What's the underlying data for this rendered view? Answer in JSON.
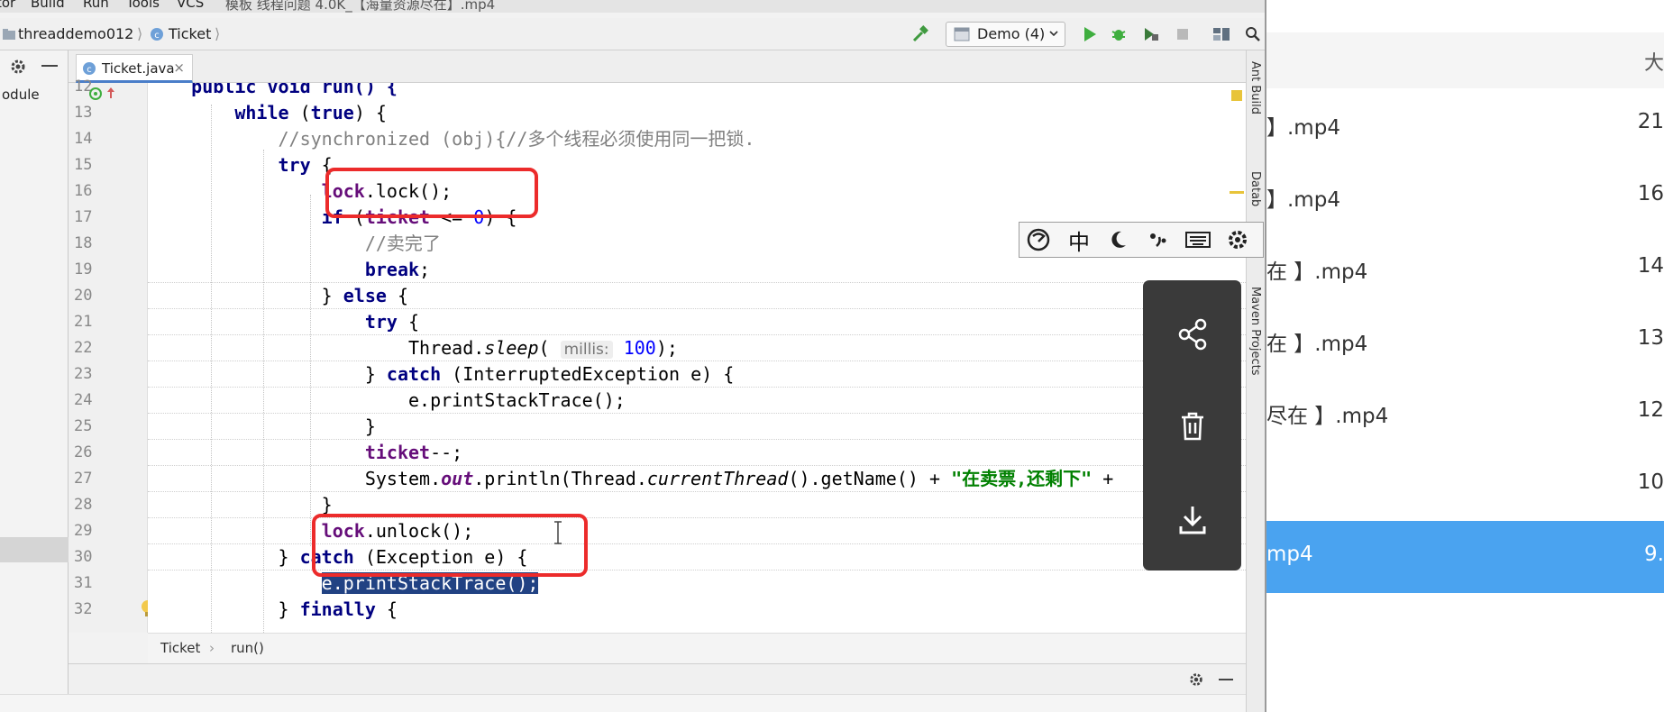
{
  "menu": {
    "items": [
      "tor",
      "Build",
      "Run",
      "Tools",
      "VCS"
    ],
    "title_fragment": "模板 线程问题 4.0K_【海量资源尽在】.mp4"
  },
  "breadcrumb": {
    "project": "threaddemo012",
    "class": "Ticket"
  },
  "run_config": {
    "label": "Demo (4)"
  },
  "project_panel": {
    "label": "odule"
  },
  "editor_tab": {
    "label": "Ticket.java",
    "close": "×"
  },
  "code": {
    "line_numbers": [
      "12",
      "13",
      "14",
      "15",
      "16",
      "17",
      "18",
      "19",
      "20",
      "21",
      "22",
      "23",
      "24",
      "25",
      "26",
      "27",
      "28",
      "29",
      "30",
      "31",
      "32"
    ],
    "lines": [
      {
        "ln": "12",
        "parts": [
          {
            "t": "    public void run() {",
            "c": "kw"
          }
        ]
      },
      {
        "ln": "13",
        "parts": [
          {
            "t": "        while",
            "c": "kw"
          },
          {
            "t": " (",
            "c": ""
          },
          {
            "t": "true",
            "c": "kw"
          },
          {
            "t": ") {",
            "c": ""
          }
        ]
      },
      {
        "ln": "14",
        "parts": [
          {
            "t": "            //synchronized (obj){//多个线程必须使用同一把锁.",
            "c": "cm"
          }
        ]
      },
      {
        "ln": "15",
        "parts": [
          {
            "t": "            try",
            "c": "kw"
          },
          {
            "t": " {",
            "c": ""
          }
        ]
      },
      {
        "ln": "16",
        "parts": [
          {
            "t": "                ",
            "c": ""
          },
          {
            "t": "lock",
            "c": "fd2"
          },
          {
            "t": ".lock();",
            "c": ""
          }
        ]
      },
      {
        "ln": "17",
        "parts": [
          {
            "t": "                if",
            "c": "kw"
          },
          {
            "t": " (",
            "c": ""
          },
          {
            "t": "ticket",
            "c": "fd2"
          },
          {
            "t": " <= ",
            "c": ""
          },
          {
            "t": "0",
            "c": "nm"
          },
          {
            "t": ") {",
            "c": ""
          }
        ]
      },
      {
        "ln": "18",
        "parts": [
          {
            "t": "                    //卖完了",
            "c": "cm"
          }
        ]
      },
      {
        "ln": "19",
        "parts": [
          {
            "t": "                    break",
            "c": "kw"
          },
          {
            "t": ";",
            "c": ""
          }
        ]
      },
      {
        "ln": "20",
        "parts": [
          {
            "t": "                } ",
            "c": ""
          },
          {
            "t": "else",
            "c": "kw"
          },
          {
            "t": " {",
            "c": ""
          }
        ]
      },
      {
        "ln": "21",
        "parts": [
          {
            "t": "                    try",
            "c": "kw"
          },
          {
            "t": " {",
            "c": ""
          }
        ]
      },
      {
        "ln": "22",
        "parts": [
          {
            "t": "                        Thread.",
            "c": ""
          },
          {
            "t": "sleep",
            "c": "it"
          },
          {
            "t": "( ",
            "c": ""
          },
          {
            "t": "millis:",
            "c": "hint"
          },
          {
            "t": " ",
            "c": ""
          },
          {
            "t": "100",
            "c": "nm"
          },
          {
            "t": ");",
            "c": ""
          }
        ]
      },
      {
        "ln": "23",
        "parts": [
          {
            "t": "                    } ",
            "c": ""
          },
          {
            "t": "catch",
            "c": "kw"
          },
          {
            "t": " (InterruptedException e) {",
            "c": ""
          }
        ]
      },
      {
        "ln": "24",
        "parts": [
          {
            "t": "                        e.printStackTrace();",
            "c": ""
          }
        ]
      },
      {
        "ln": "25",
        "parts": [
          {
            "t": "                    }",
            "c": ""
          }
        ]
      },
      {
        "ln": "26",
        "parts": [
          {
            "t": "                    ",
            "c": ""
          },
          {
            "t": "ticket",
            "c": "fd2"
          },
          {
            "t": "--;",
            "c": ""
          }
        ]
      },
      {
        "ln": "27",
        "parts": [
          {
            "t": "                    System.",
            "c": ""
          },
          {
            "t": "out",
            "c": "fd"
          },
          {
            "t": ".println(Thread.",
            "c": ""
          },
          {
            "t": "currentThread",
            "c": "it"
          },
          {
            "t": "().getName() + ",
            "c": ""
          },
          {
            "t": "\"在卖票,还剩下\"",
            "c": "st"
          },
          {
            "t": " +",
            "c": ""
          }
        ]
      },
      {
        "ln": "28",
        "parts": [
          {
            "t": "                }",
            "c": ""
          }
        ]
      },
      {
        "ln": "29",
        "parts": [
          {
            "t": "                ",
            "c": ""
          },
          {
            "t": "lock",
            "c": "fd2"
          },
          {
            "t": ".unlock();",
            "c": ""
          }
        ]
      },
      {
        "ln": "30",
        "parts": [
          {
            "t": "            } ",
            "c": ""
          },
          {
            "t": "catch",
            "c": "kw"
          },
          {
            "t": " (Exception e) {",
            "c": ""
          }
        ]
      },
      {
        "ln": "31",
        "parts": [
          {
            "t": "                ",
            "c": ""
          },
          {
            "t": "e.printStackTrace();",
            "c": "sel"
          }
        ]
      },
      {
        "ln": "32",
        "parts": [
          {
            "t": "            } ",
            "c": ""
          },
          {
            "t": "finally",
            "c": "kw"
          },
          {
            "t": " {",
            "c": ""
          }
        ]
      }
    ]
  },
  "editor_breadcrumb": {
    "class": "Ticket",
    "method": "run()"
  },
  "side_tools": {
    "ant": "Ant Build",
    "database": "Datab",
    "maven": "Maven Projects"
  },
  "ime": {
    "chinese": "中"
  },
  "files": {
    "size_header": "大",
    "rows": [
      {
        "name": "】.mp4",
        "size": "21"
      },
      {
        "name": "】.mp4",
        "size": "16"
      },
      {
        "name": "在 】.mp4",
        "size": "14"
      },
      {
        "name": "在 】.mp4",
        "size": "13"
      },
      {
        "name": "尽在 】.mp4",
        "size": "12"
      },
      {
        "name": "",
        "size": "10"
      },
      {
        "name": "mp4",
        "size": "9.",
        "active": true
      }
    ]
  },
  "colors": {
    "accent": "#4aa3f0",
    "highlight_box": "#ec2b2b",
    "action_panel": "#3a3a3a"
  }
}
